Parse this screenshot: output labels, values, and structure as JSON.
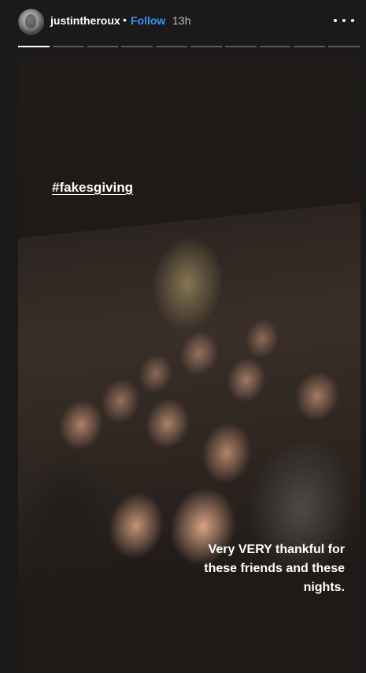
{
  "header": {
    "username": "justintheroux",
    "separator": "•",
    "follow_label": "Follow",
    "time_ago": "13h",
    "avatar_icon": "profile-avatar",
    "more_icon": "more-options-icon"
  },
  "progress": {
    "segments": 10,
    "active_index": 0
  },
  "story": {
    "hashtag": "#fakesgiving",
    "caption_line1": "Very VERY thankful for",
    "caption_line2": "these friends and these",
    "caption_line3": "nights."
  },
  "colors": {
    "follow": "#3897f0",
    "background": "#1a1a1a",
    "progress_active": "#ffffff",
    "progress_inactive": "#5a5a5a"
  }
}
